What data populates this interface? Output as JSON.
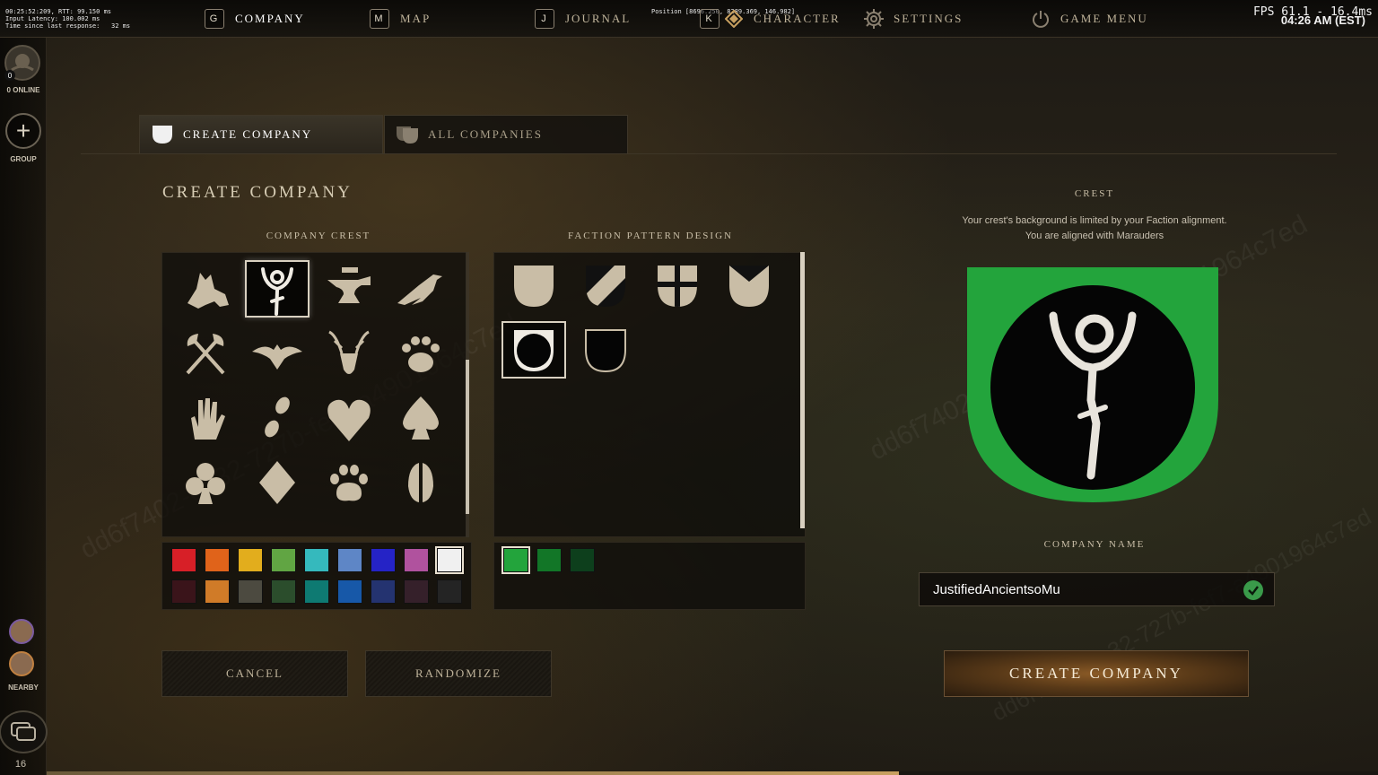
{
  "debug": {
    "lines": [
      "00:25:52:209, RTT: 99.150 ms",
      "Input Latency: 100.002 ms",
      "Time since last response:   32 ms"
    ],
    "position": "Position [8696.250, 8289.369, 146.982]",
    "fps": "FPS 61.1 - 16.4ms",
    "clock": "04:26 AM (EST)"
  },
  "nav": {
    "company": {
      "key": "G",
      "label": "COMPANY"
    },
    "map": {
      "key": "M",
      "label": "MAP"
    },
    "journal": {
      "key": "J",
      "label": "JOURNAL"
    },
    "character": {
      "key": "K",
      "label": "CHARACTER"
    },
    "settings": {
      "label": "SETTINGS"
    },
    "game_menu": {
      "label": "GAME MENU"
    }
  },
  "sidebar": {
    "online_count_badge": "0",
    "online": "0 ONLINE",
    "group": "GROUP",
    "nearby": "NEARBY",
    "level": "16"
  },
  "xp_progress": 0.64,
  "tabs": [
    {
      "label": "CREATE COMPANY",
      "active": true
    },
    {
      "label": "ALL COMPANIES",
      "active": false
    }
  ],
  "main": {
    "heading": "CREATE COMPANY",
    "company_crest_label": "COMPANY CREST",
    "faction_pattern_label": "FACTION PATTERN DESIGN",
    "crest_icons": [
      "wolf-icon",
      "marauder-sigil-icon",
      "anvil-icon",
      "raven-icon",
      "crossed-axes-icon",
      "eagle-icon",
      "stag-icon",
      "bear-paw-icon",
      "hand-icon",
      "footprints-icon",
      "heart-icon",
      "spade-icon",
      "club-icon",
      "diamond-icon",
      "wolf-paw-icon",
      "hoof-print-icon"
    ],
    "selected_icon_index": 1,
    "patterns": [
      "plain-shield-icon",
      "diagonal-shield-icon",
      "cross-shield-icon",
      "chevron-shield-icon",
      "circle-shield-icon",
      "outline-shield-icon"
    ],
    "selected_pattern_index": 4,
    "icon_colors": [
      "#d71f27",
      "#e0631a",
      "#e2ad1d",
      "#61a543",
      "#35b9bd",
      "#5e86c6",
      "#2523c6",
      "#b0529e",
      "#f0f0f0",
      "#3a141a",
      "#d07b28",
      "#4c4a40",
      "#2b4d2c",
      "#0e7a72",
      "#1758a8",
      "#243370",
      "#35202a",
      "#242424"
    ],
    "selected_icon_color_index": 8,
    "faction_colors": [
      "#23a43c",
      "#127627",
      "#0d3f1c"
    ],
    "selected_faction_color_index": 0,
    "cancel": "CANCEL",
    "randomize": "RANDOMIZE"
  },
  "crest": {
    "title": "CREST",
    "desc_line1": "Your crest's background is limited by your Faction alignment.",
    "desc_line2": "You are aligned with Marauders",
    "background_color": "#23a43c"
  },
  "company_name": {
    "label": "COMPANY NAME",
    "value": "JustifiedAncientsoMu"
  },
  "create_button": "CREATE COMPANY",
  "watermark": "dd6f7402-da32-727b-fef7-a4901964c7ed"
}
